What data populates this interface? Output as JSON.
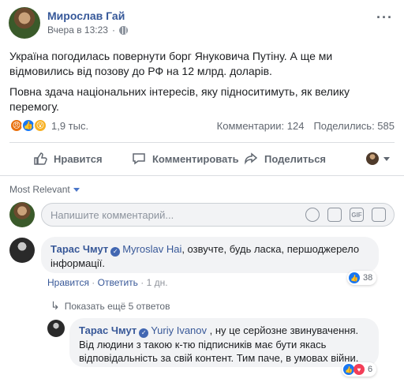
{
  "post": {
    "author": "Мирослав Гай",
    "time": "Вчера в 13:23",
    "more": "···",
    "paragraph1": "Україна погодилась повернути борг Януковича Путіну. А ще ми відмовились від позову до РФ на 12 млрд. доларів.",
    "paragraph2": "Повна здача національних інтересів, яку підноситимуть, як велику перемогу.",
    "reaction_count": "1,9 тыс.",
    "comments_count": "Комментарии: 124",
    "shares_count": "Поделились: 585"
  },
  "actions": {
    "like": "Нравится",
    "comment": "Комментировать",
    "share": "Поделиться"
  },
  "sort": {
    "label": "Most Relevant"
  },
  "composer": {
    "placeholder": "Напишите комментарий..."
  },
  "comments": [
    {
      "author": "Тарас Чмут",
      "mention": "Myroslav Hai",
      "text": ", озвучте, будь ласка, першоджерело інформації.",
      "like": "Нравится",
      "reply": "Ответить",
      "time": "1 дн.",
      "likes": "38"
    }
  ],
  "replies_link": "Показать ещё 5 ответов",
  "reply": {
    "author": "Тарас Чмут",
    "mention": "Yuriy Ivanov",
    "text": " , ну це серйозне звинувачення. Від людини з такою к-тю підписників має бути якась відповідальність за свій контент. Тим паче, в умовах війни.",
    "likes": "6"
  },
  "colors": {
    "link": "#385898",
    "like_blue": "#1877f2",
    "heart_red": "#f33e58",
    "angry_orange": "#e9710f",
    "wow_yellow": "#f7b125"
  }
}
